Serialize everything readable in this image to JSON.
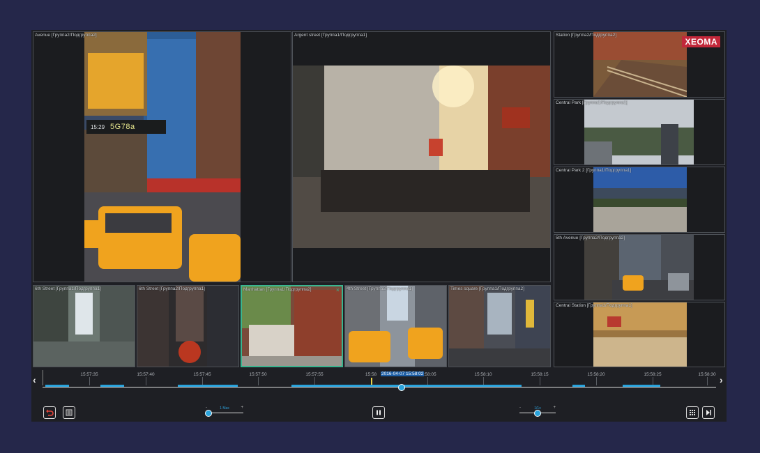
{
  "app": {
    "brand": "XEOMA",
    "colors": {
      "background": "#25274a",
      "panel": "#1e1f24",
      "accent": "#29a3dc",
      "selected_border": "#39b58f",
      "cursor": "#e6d24a"
    }
  },
  "cameras": {
    "avenue": {
      "label": "Avenue [Группа2/Подгруппа2]",
      "plate_time": "15:29",
      "plate_number": "5G78a"
    },
    "argent": {
      "label": "Argent street [Группа1/Подгруппа1]"
    },
    "station": {
      "label": "Station [Группа2/Подгруппа2]"
    },
    "central_park": {
      "label": "Central Park [Группа1/Подгруппа1]"
    },
    "central_park_2": {
      "label": "Central Park 2 [Группа1/Подгруппа1]"
    },
    "fifth_avenue": {
      "label": "5th Avenue [Группа2/Подгруппа2]"
    },
    "central_station": {
      "label": "Central Station [Группа1/Подгруппа1]"
    },
    "sixth_street_a": {
      "label": "6th Street [Группа1/Подгруппа1]"
    },
    "sixth_street_b": {
      "label": "6th Street [Группа2/Подгруппа1]"
    },
    "manhattan": {
      "label": "Manhattan [Группа1/Подгруппа2]",
      "close": "×"
    },
    "fourth_street": {
      "label": "4th Street [Группа2/Подгруппа1]"
    },
    "times_square": {
      "label": "Times square [Группа1/Подгруппа2]"
    }
  },
  "timeline": {
    "prev": "‹",
    "next": "›",
    "ticks": [
      "15:57:35",
      "15:57:40",
      "15:57:45",
      "15:57:50",
      "15:57:55",
      "15:58",
      "15:58:05",
      "15:58:10",
      "15:58:15",
      "15:58:20",
      "15:58:25",
      "15:58:30"
    ],
    "current_datetime": "2016-04-07 15:58:02",
    "position": 0.53
  },
  "controls": {
    "speed": {
      "caption": "1 Max",
      "minus": "-",
      "plus": "+",
      "level": 0.0
    },
    "volume": {
      "caption": "1/1x",
      "minus": "-",
      "plus": "+",
      "level": 0.5
    },
    "icons": {
      "back": "undo-icon",
      "list": "list-icon",
      "pause": "pause-icon",
      "grid": "grid-icon",
      "next": "skip-forward-icon"
    }
  }
}
